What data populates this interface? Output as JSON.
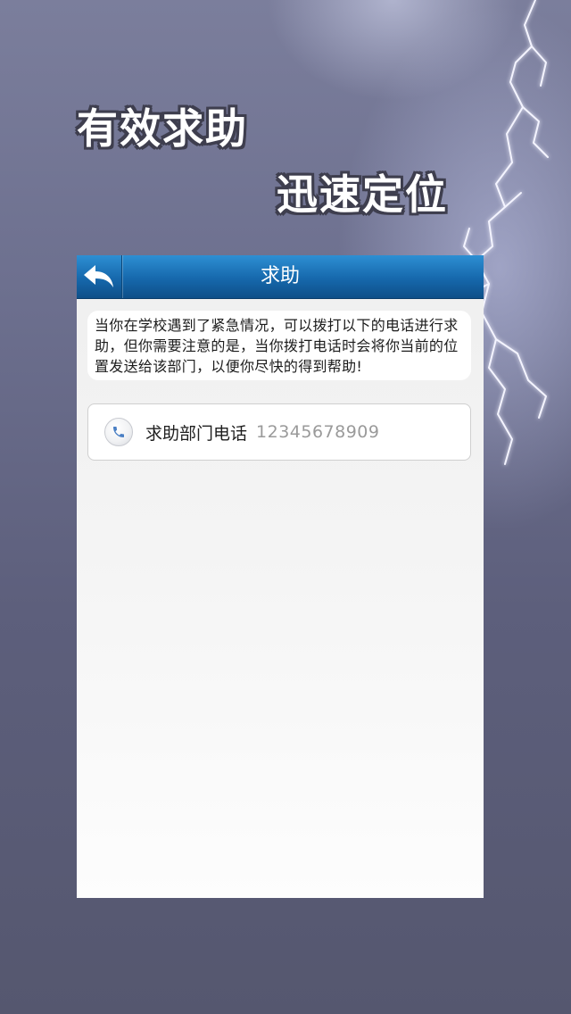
{
  "slogans": {
    "line1": "有效求助",
    "line2": "迅速定位"
  },
  "nav": {
    "title": "求助",
    "back_icon": "back-arrow-icon"
  },
  "info": {
    "text": "当你在学校遇到了紧急情况，可以拨打以下的电话进行求助，但你需要注意的是，当你拨打电话时会将你当前的位置发送给该部门，以便你尽快的得到帮助!"
  },
  "contact": {
    "icon": "phone-icon",
    "label": "求助部门电话",
    "number": "12345678909"
  },
  "colors": {
    "nav_bar": "#1668ac",
    "background": "#6c6f8e"
  }
}
